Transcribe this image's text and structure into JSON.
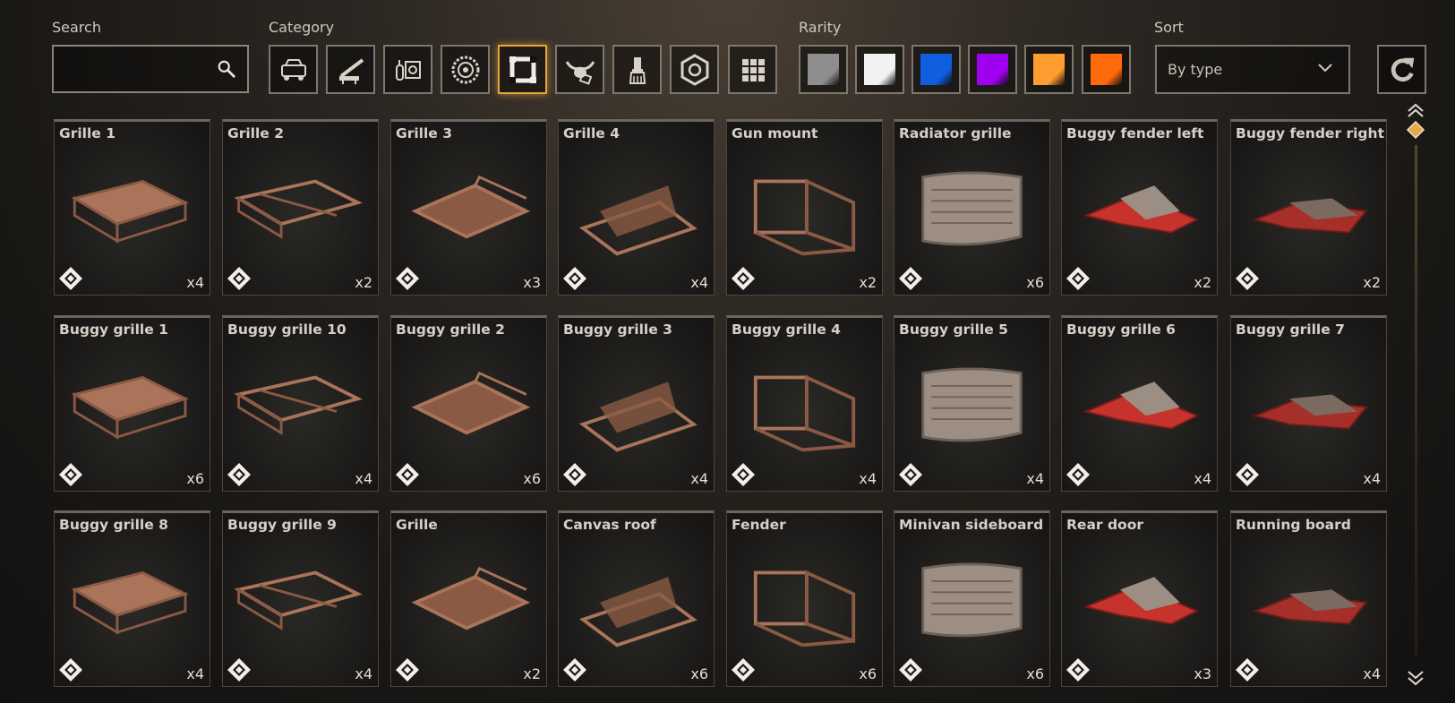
{
  "filters": {
    "search_label": "Search",
    "search_value": "",
    "category_label": "Category",
    "rarity_label": "Rarity",
    "sort_label": "Sort",
    "sort_value": "By type"
  },
  "categories": [
    {
      "icon": "car-body-icon",
      "active": false
    },
    {
      "icon": "cannon-icon",
      "active": false
    },
    {
      "icon": "engine-parts-icon",
      "active": false
    },
    {
      "icon": "wheel-icon",
      "active": false
    },
    {
      "icon": "frame-parts-icon",
      "active": true
    },
    {
      "icon": "bull-horns-icon",
      "active": false
    },
    {
      "icon": "paint-brush-icon",
      "active": false
    },
    {
      "icon": "resource-hex-icon",
      "active": false
    },
    {
      "icon": "grid-all-icon",
      "active": false
    }
  ],
  "rarities": [
    {
      "name": "common",
      "color": "#8e8e8e"
    },
    {
      "name": "uncommon",
      "color": "#f2f2f2"
    },
    {
      "name": "rare",
      "color": "#0f5fe0"
    },
    {
      "name": "epic",
      "color": "#a000f0"
    },
    {
      "name": "legendary",
      "color": "#ff9d30"
    },
    {
      "name": "relic",
      "color": "#ff6a0a"
    }
  ],
  "items": [
    {
      "name": "Grille 1",
      "qty": "x4"
    },
    {
      "name": "Grille 2",
      "qty": "x2"
    },
    {
      "name": "Grille 3",
      "qty": "x3"
    },
    {
      "name": "Grille 4",
      "qty": "x4"
    },
    {
      "name": "Gun mount",
      "qty": "x2"
    },
    {
      "name": "Radiator grille",
      "qty": "x6"
    },
    {
      "name": "Buggy fender left",
      "qty": "x2"
    },
    {
      "name": "Buggy fender right",
      "qty": "x2"
    },
    {
      "name": "Buggy grille 1",
      "qty": "x6"
    },
    {
      "name": "Buggy grille 10",
      "qty": "x4"
    },
    {
      "name": "Buggy grille 2",
      "qty": "x6"
    },
    {
      "name": "Buggy grille 3",
      "qty": "x4"
    },
    {
      "name": "Buggy grille 4",
      "qty": "x4"
    },
    {
      "name": "Buggy grille 5",
      "qty": "x4"
    },
    {
      "name": "Buggy grille 6",
      "qty": "x4"
    },
    {
      "name": "Buggy grille 7",
      "qty": "x4"
    },
    {
      "name": "Buggy grille 8",
      "qty": "x4"
    },
    {
      "name": "Buggy grille 9",
      "qty": "x4"
    },
    {
      "name": "Grille",
      "qty": "x2"
    },
    {
      "name": "Canvas roof",
      "qty": "x6"
    },
    {
      "name": "Fender",
      "qty": "x6"
    },
    {
      "name": "Minivan sideboard",
      "qty": "x6"
    },
    {
      "name": "Rear door",
      "qty": "x3"
    },
    {
      "name": "Running board",
      "qty": "x4"
    }
  ]
}
